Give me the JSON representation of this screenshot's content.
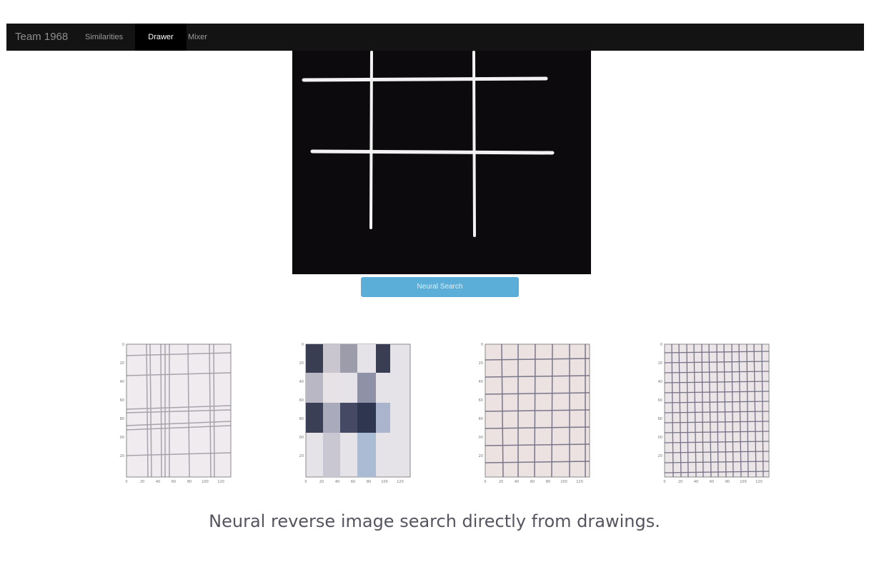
{
  "navbar": {
    "brand": "Team 1968",
    "items": [
      {
        "label": "Similarities",
        "active": false
      },
      {
        "label": "Drawer",
        "active": true
      },
      {
        "label": "Mixer",
        "active": false
      }
    ]
  },
  "canvas": {
    "background": "#0d0a0d",
    "stroke_color": "#f2f2f2"
  },
  "search_button": {
    "label": "Neural Search",
    "color": "#5aaed8"
  },
  "results": {
    "y_ticks": [
      "0",
      "20",
      "40",
      "60",
      "80",
      "100",
      "120"
    ],
    "x_ticks": [
      "0",
      "20",
      "40",
      "60",
      "80",
      "100",
      "120"
    ],
    "items": [
      {
        "pattern": "faded plaid"
      },
      {
        "pattern": "gingham check"
      },
      {
        "pattern": "windowpane grid"
      },
      {
        "pattern": "tattersall check"
      }
    ]
  },
  "caption": "Neural reverse image search directly from drawings."
}
